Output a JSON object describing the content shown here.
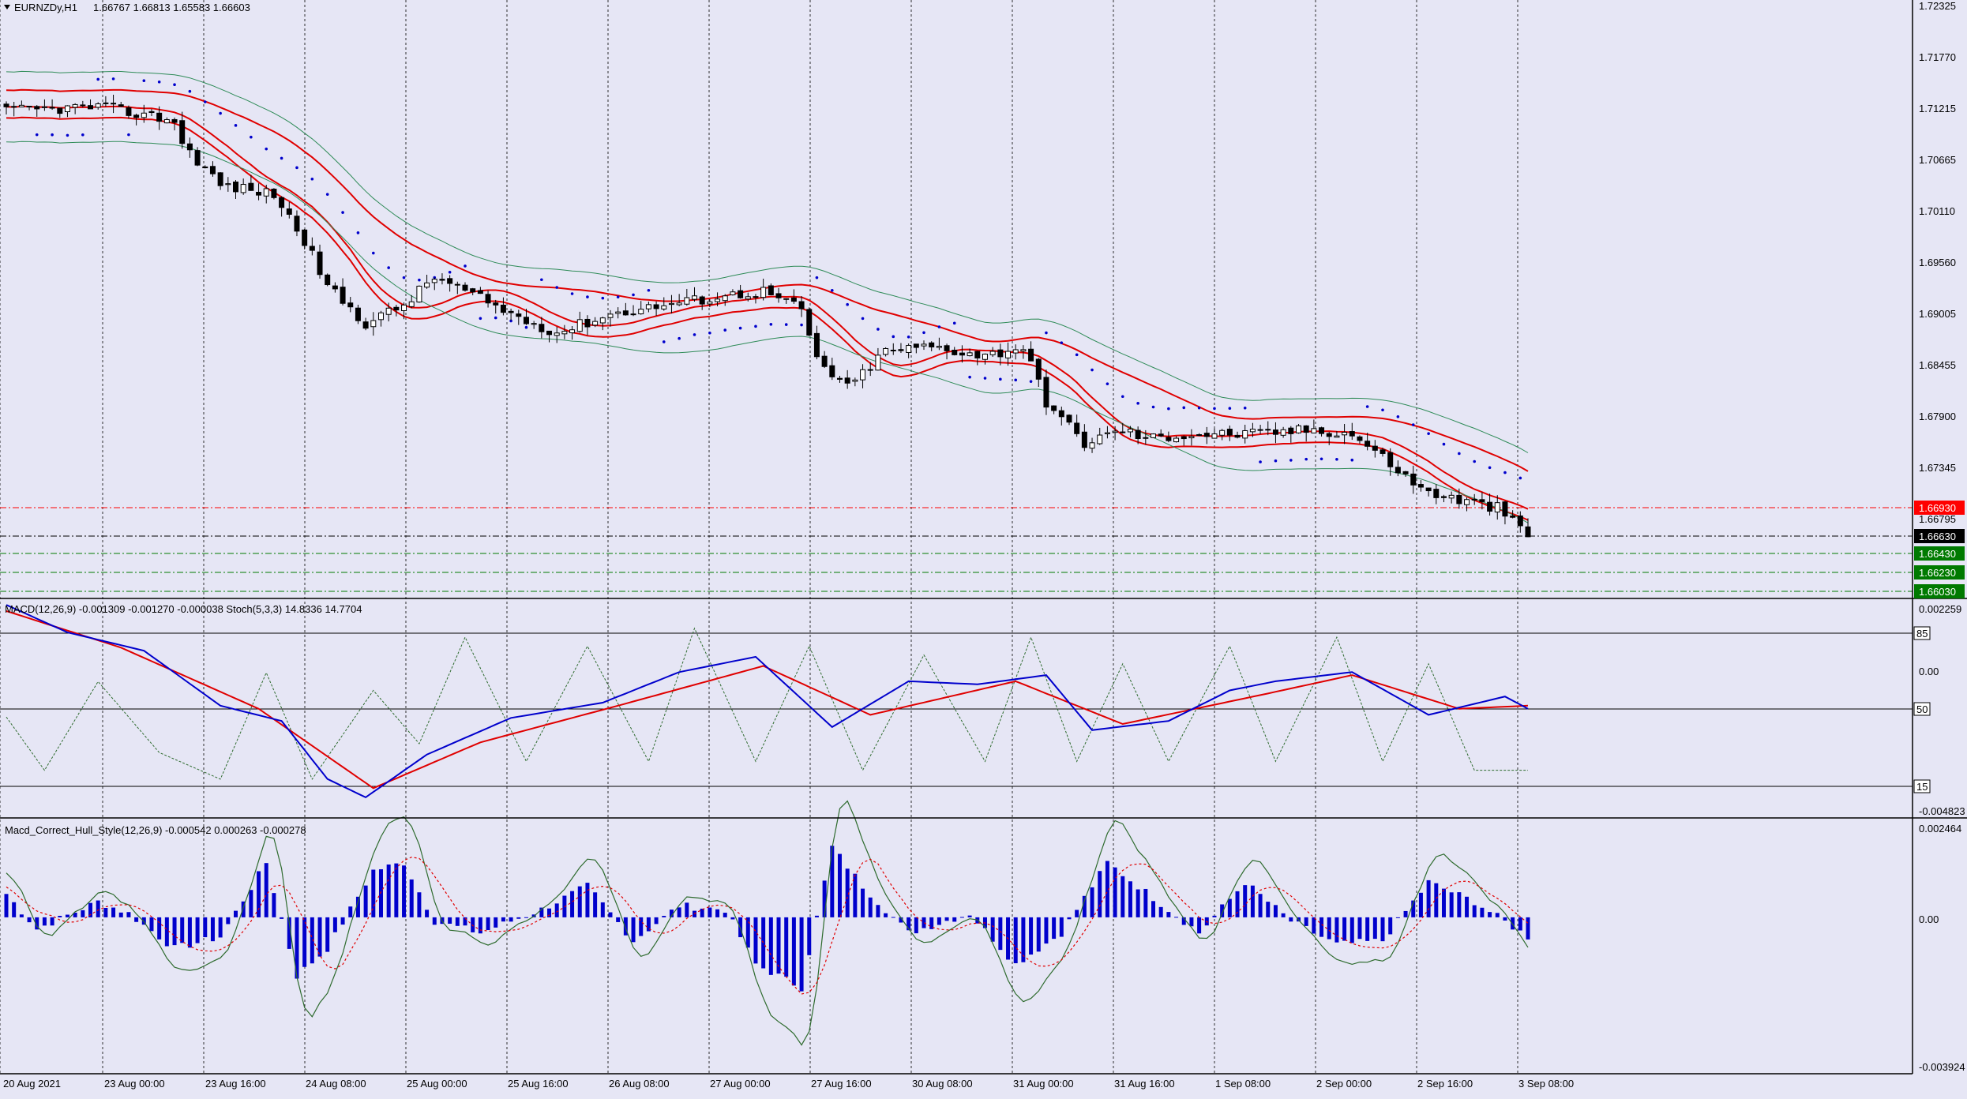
{
  "header": {
    "symbol_label": "EURNZDy,H1",
    "ohlc_label": "1.66767 1.66813 1.65583 1.66603"
  },
  "indicators": {
    "macd_stoch_label": "MACD(12,26,9) -0.001309 -0.001270 -0.000038  Stoch(5,3,3) 14.8336 14.7704",
    "hull_label": "Macd_Correct_Hull_Style(12,26,9) -0.000542 0.000263 -0.000278"
  },
  "colors": {
    "background": "#e6e6f5",
    "axis": "#000000",
    "grid_vertical": "#000000",
    "ma_bands": "#e00000",
    "bollinger": "#2e8b57",
    "parabolic_sar": "#0000cc",
    "macd_main": "#0000cc",
    "macd_signal": "#e00000",
    "stoch": "#2e6b2e",
    "histogram": "#0000cc",
    "price_marker_red": "#ff0000",
    "price_marker_black": "#000000",
    "price_marker_green": "#007a00"
  },
  "price_axis": {
    "ticks": [
      "1.72325",
      "1.71770",
      "1.71215",
      "1.70665",
      "1.70110",
      "1.69560",
      "1.69005",
      "1.68455",
      "1.67900",
      "1.67345",
      "1.66795"
    ],
    "markers": [
      {
        "value": "1.66930",
        "style": "red"
      },
      {
        "value": "1.66630",
        "style": "black"
      },
      {
        "value": "1.66430",
        "style": "green"
      },
      {
        "value": "1.66230",
        "style": "green"
      },
      {
        "value": "1.66030",
        "style": "green"
      }
    ]
  },
  "panel2_axis": {
    "ticks": [
      "0.002259",
      "0.00",
      "-0.004823"
    ],
    "levels": [
      "85",
      "50",
      "15"
    ]
  },
  "panel3_axis": {
    "ticks": [
      "0.002464",
      "0.00",
      "-0.003924"
    ]
  },
  "time_axis": {
    "labels": [
      "20 Aug 2021",
      "23 Aug 00:00",
      "23 Aug 16:00",
      "24 Aug 08:00",
      "25 Aug 00:00",
      "25 Aug 16:00",
      "26 Aug 08:00",
      "27 Aug 00:00",
      "27 Aug 16:00",
      "30 Aug 08:00",
      "31 Aug 00:00",
      "31 Aug 16:00",
      "1 Sep 08:00",
      "2 Sep 00:00",
      "2 Sep 16:00",
      "3 Sep 08:00"
    ]
  },
  "chart_data": [
    {
      "type": "candlestick",
      "panel": "main",
      "title": "EURNZDy,H1",
      "ylim": [
        1.6597,
        1.7237
      ],
      "bars": 200,
      "close_path": [
        [
          0,
          1.712
        ],
        [
          12,
          1.7125
        ],
        [
          22,
          1.711
        ],
        [
          23,
          1.7085
        ],
        [
          28,
          1.704
        ],
        [
          35,
          1.703
        ],
        [
          39,
          1.698
        ],
        [
          42,
          1.693
        ],
        [
          47,
          1.689
        ],
        [
          52,
          1.691
        ],
        [
          56,
          1.694
        ],
        [
          60,
          1.6925
        ],
        [
          66,
          1.69
        ],
        [
          72,
          1.688
        ],
        [
          79,
          1.69
        ],
        [
          86,
          1.691
        ],
        [
          94,
          1.692
        ],
        [
          99,
          1.6925
        ],
        [
          104,
          1.6905
        ],
        [
          106,
          1.685
        ],
        [
          110,
          1.682
        ],
        [
          115,
          1.686
        ],
        [
          121,
          1.6865
        ],
        [
          128,
          1.6855
        ],
        [
          133,
          1.6865
        ],
        [
          136,
          1.6805
        ],
        [
          141,
          1.676
        ],
        [
          146,
          1.6775
        ],
        [
          149,
          1.6765
        ],
        [
          155,
          1.677
        ],
        [
          163,
          1.677
        ],
        [
          171,
          1.6775
        ],
        [
          176,
          1.677
        ],
        [
          180,
          1.6745
        ],
        [
          185,
          1.671
        ],
        [
          189,
          1.67
        ],
        [
          195,
          1.669
        ],
        [
          199,
          1.666
        ]
      ],
      "overlays": [
        "moving-average-bands",
        "bollinger-bands",
        "parabolic-sar"
      ]
    },
    {
      "type": "line",
      "panel": "indicator-1",
      "title": "MACD(12,26,9)  Stoch(5,3,3)",
      "ylim": [
        -0.004823,
        0.002259
      ],
      "series": [
        {
          "name": "MACD",
          "path": [
            [
              0,
              0.0021
            ],
            [
              8,
              0.0012
            ],
            [
              18,
              0.0006
            ],
            [
              28,
              -0.0012
            ],
            [
              36,
              -0.0017
            ],
            [
              42,
              -0.0036
            ],
            [
              47,
              -0.0042
            ],
            [
              55,
              -0.0028
            ],
            [
              66,
              -0.0016
            ],
            [
              78,
              -0.0011
            ],
            [
              88,
              -0.0001
            ],
            [
              98,
              0.0004
            ],
            [
              108,
              -0.0019
            ],
            [
              118,
              -0.0004
            ],
            [
              127,
              -0.0005
            ],
            [
              136,
              -0.0002
            ],
            [
              142,
              -0.002
            ],
            [
              152,
              -0.0017
            ],
            [
              160,
              -0.0007
            ],
            [
              166,
              -0.0004
            ],
            [
              176,
              -0.0001
            ],
            [
              186,
              -0.0015
            ],
            [
              196,
              -0.0009
            ],
            [
              199,
              -0.0013
            ]
          ]
        },
        {
          "name": "Signal",
          "path": [
            [
              0,
              0.0019
            ],
            [
              15,
              0.0007
            ],
            [
              33,
              -0.0013
            ],
            [
              48,
              -0.0039
            ],
            [
              62,
              -0.0024
            ],
            [
              80,
              -0.0012
            ],
            [
              99,
              0.0001
            ],
            [
              113,
              -0.0015
            ],
            [
              132,
              -0.0004
            ],
            [
              146,
              -0.0018
            ],
            [
              165,
              -0.0008
            ],
            [
              176,
              -0.0002
            ],
            [
              190,
              -0.0013
            ],
            [
              199,
              -0.0012
            ]
          ]
        },
        {
          "name": "Stoch",
          "path": [
            [
              0,
              45
            ],
            [
              5,
              15
            ],
            [
              12,
              65
            ],
            [
              20,
              25
            ],
            [
              28,
              10
            ],
            [
              34,
              70
            ],
            [
              40,
              10
            ],
            [
              48,
              60
            ],
            [
              54,
              30
            ],
            [
              60,
              90
            ],
            [
              68,
              20
            ],
            [
              76,
              85
            ],
            [
              84,
              20
            ],
            [
              90,
              95
            ],
            [
              98,
              20
            ],
            [
              105,
              85
            ],
            [
              112,
              15
            ],
            [
              120,
              80
            ],
            [
              128,
              20
            ],
            [
              134,
              90
            ],
            [
              140,
              20
            ],
            [
              146,
              75
            ],
            [
              152,
              20
            ],
            [
              160,
              85
            ],
            [
              166,
              20
            ],
            [
              174,
              90
            ],
            [
              180,
              20
            ],
            [
              186,
              75
            ],
            [
              192,
              15
            ],
            [
              199,
              15
            ]
          ]
        }
      ],
      "levels": [
        85,
        50,
        15
      ]
    },
    {
      "type": "bar",
      "panel": "indicator-2",
      "title": "Macd_Correct_Hull_Style(12,26,9)",
      "ylim": [
        -0.003924,
        0.002464
      ],
      "histogram_path": [
        [
          0,
          0.0006
        ],
        [
          4,
          -0.0003
        ],
        [
          12,
          0.0004
        ],
        [
          16,
          0.0001
        ],
        [
          22,
          -0.0008
        ],
        [
          28,
          -0.0005
        ],
        [
          34,
          0.0014
        ],
        [
          38,
          -0.0015
        ],
        [
          42,
          -0.0008
        ],
        [
          48,
          0.0012
        ],
        [
          52,
          0.0014
        ],
        [
          56,
          -0.0001
        ],
        [
          62,
          -0.0004
        ],
        [
          70,
          0.0002
        ],
        [
          76,
          0.0008
        ],
        [
          82,
          -0.0006
        ],
        [
          88,
          0.0003
        ],
        [
          94,
          0.0002
        ],
        [
          98,
          -0.0012
        ],
        [
          104,
          -0.0018
        ],
        [
          108,
          0.0018
        ],
        [
          112,
          0.0008
        ],
        [
          118,
          -0.0004
        ],
        [
          126,
          0.0001
        ],
        [
          132,
          -0.0012
        ],
        [
          138,
          -0.0004
        ],
        [
          144,
          0.0014
        ],
        [
          150,
          0.0005
        ],
        [
          156,
          -0.0004
        ],
        [
          162,
          0.0009
        ],
        [
          168,
          -0.0001
        ],
        [
          174,
          -0.0007
        ],
        [
          180,
          -0.0006
        ],
        [
          186,
          0.0009
        ],
        [
          192,
          0.0004
        ],
        [
          199,
          -0.0005
        ]
      ]
    }
  ]
}
